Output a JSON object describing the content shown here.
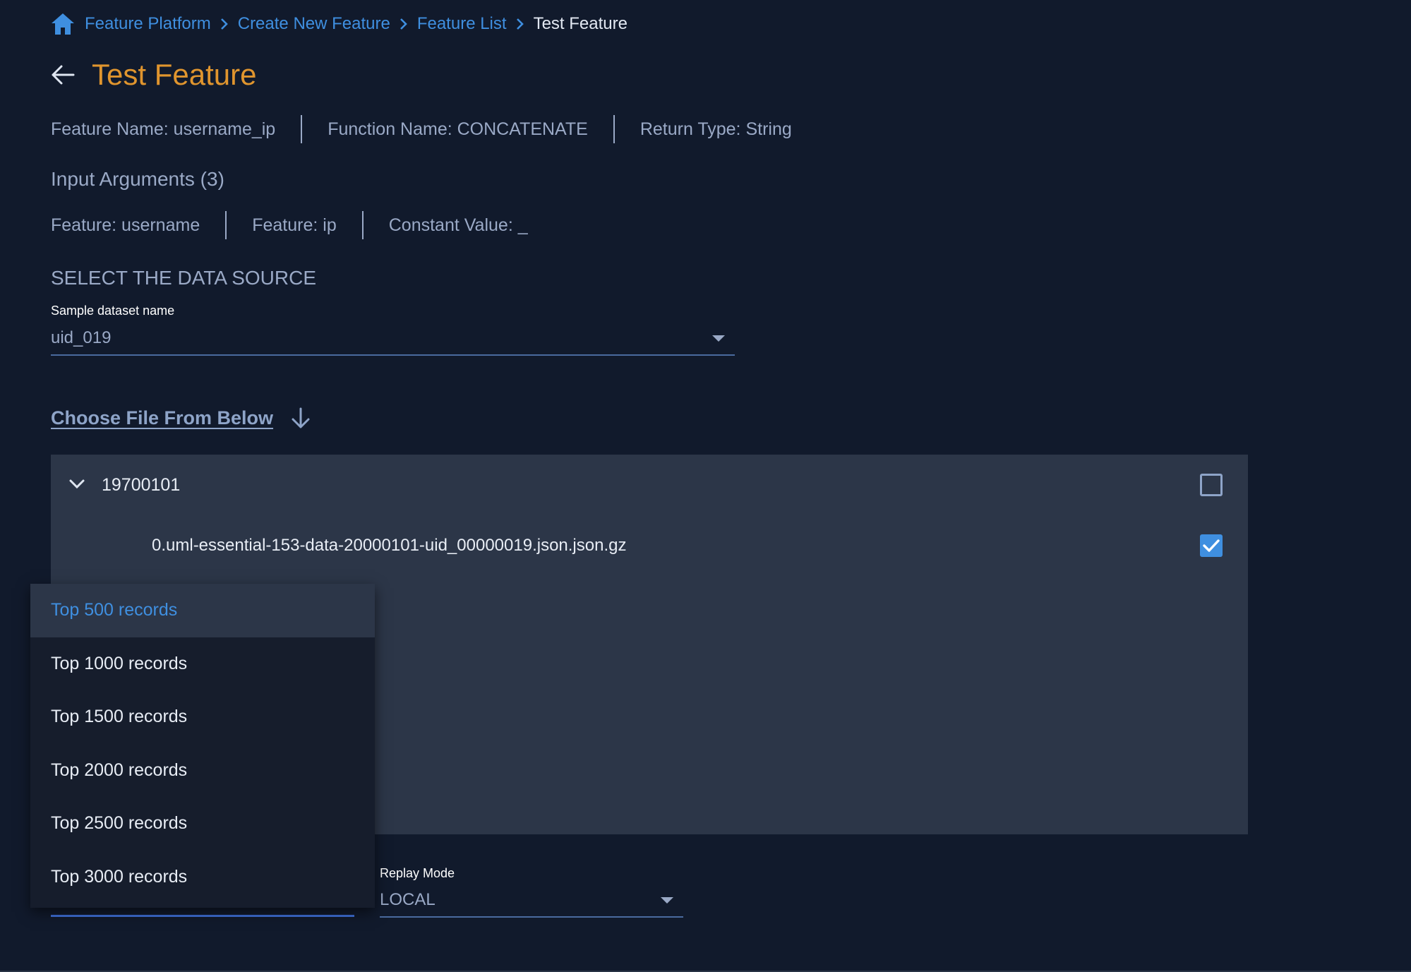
{
  "breadcrumb": {
    "items": [
      "Feature Platform",
      "Create New Feature",
      "Feature List"
    ],
    "current": "Test Feature"
  },
  "page": {
    "title": "Test Feature"
  },
  "feature_info": {
    "name": "Feature Name: username_ip",
    "function": "Function Name: CONCATENATE",
    "return_type": "Return Type: String"
  },
  "input_arguments": {
    "heading": "Input Arguments (3)",
    "items": [
      "Feature: username",
      "Feature: ip",
      "Constant Value: _"
    ]
  },
  "data_source": {
    "heading": "SELECT THE DATA SOURCE",
    "dataset_label": "Sample dataset name",
    "dataset_value": "uid_019"
  },
  "choose_file": {
    "label": "Choose File From Below"
  },
  "file_tree": {
    "folder": {
      "name": "19700101",
      "checked": false
    },
    "files": [
      {
        "name": "0.uml-essential-153-data-20000101-uid_00000019.json.json.gz",
        "checked": true
      }
    ]
  },
  "records_menu": {
    "options": [
      "Top 500 records",
      "Top 1000 records",
      "Top 1500 records",
      "Top 2000 records",
      "Top 2500 records",
      "Top 3000 records"
    ],
    "selected_index": 0
  },
  "replay_mode": {
    "label": "Replay Mode",
    "value": "LOCAL"
  },
  "colors": {
    "accent": "#3f8fe0",
    "title": "#e0952e",
    "background": "#111a2c",
    "panel": "#2c3648"
  }
}
